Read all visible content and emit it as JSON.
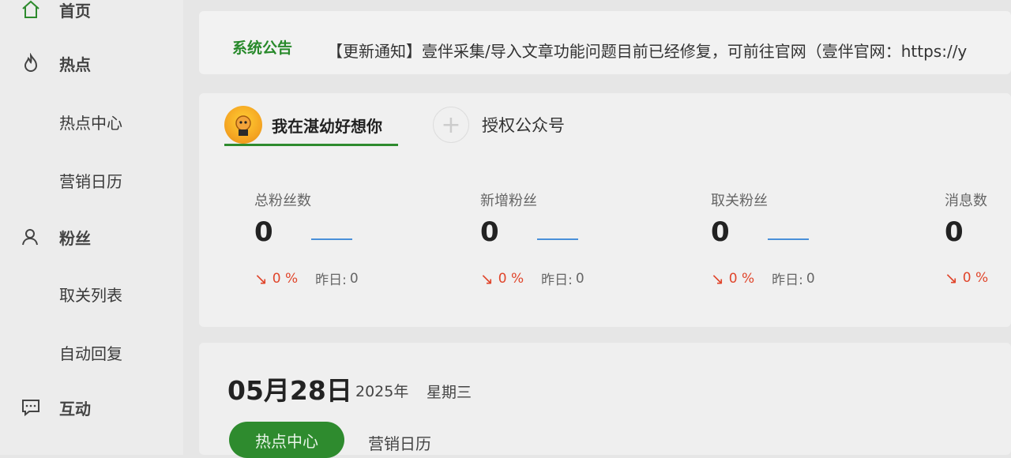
{
  "sidebar": {
    "items": [
      {
        "label": "首页",
        "icon": "home-icon"
      },
      {
        "label": "热点",
        "icon": "fire-icon"
      },
      {
        "label": "热点中心"
      },
      {
        "label": "营销日历"
      },
      {
        "label": "粉丝",
        "icon": "user-icon"
      },
      {
        "label": "取关列表"
      },
      {
        "label": "自动回复"
      },
      {
        "label": "互动",
        "icon": "chat-icon"
      }
    ]
  },
  "notice": {
    "title": "系统公告",
    "text": "【更新通知】壹伴采集/导入文章功能问题目前已经修复，可前往官网（壹伴官网：https://y"
  },
  "account": {
    "name": "我在湛幼好想你",
    "add_label": "授权公众号"
  },
  "stats": [
    {
      "label": "总粉丝数",
      "value": "0",
      "trend": "0 %",
      "yesterday_label": "昨日:",
      "yesterday_value": "0"
    },
    {
      "label": "新增粉丝",
      "value": "0",
      "trend": "0 %",
      "yesterday_label": "昨日:",
      "yesterday_value": "0"
    },
    {
      "label": "取关粉丝",
      "value": "0",
      "trend": "0 %",
      "yesterday_label": "昨日:",
      "yesterday_value": "0"
    },
    {
      "label": "消息数",
      "value": "0",
      "trend": "0 %"
    }
  ],
  "date": {
    "main": "05月28日",
    "year": "2025年",
    "weekday": "星期三"
  },
  "tabs": {
    "hot_center": "热点中心",
    "marketing_calendar": "营销日历"
  },
  "colors": {
    "accent": "#2e8b2e",
    "trend_down": "#e0452b",
    "link_line": "#4a90d9"
  }
}
